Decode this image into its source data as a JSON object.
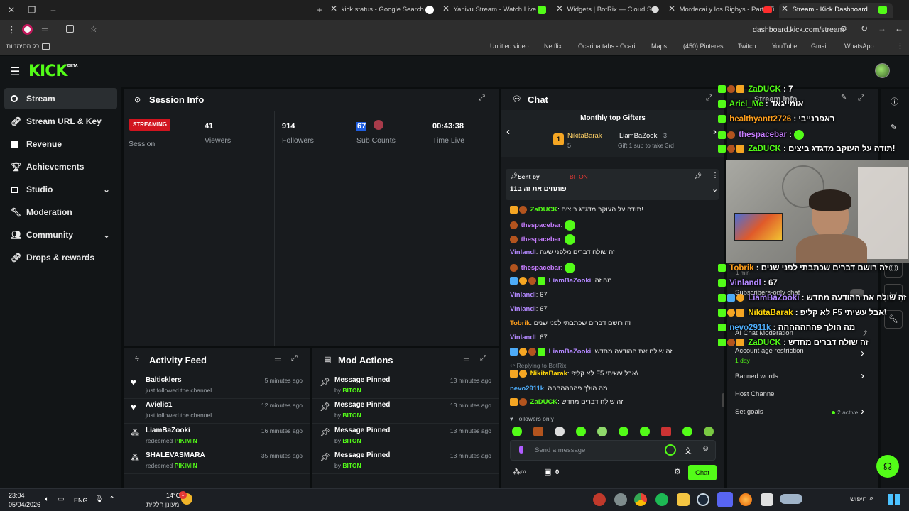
{
  "browser": {
    "tabs": [
      {
        "title": "kick status - Google Search",
        "color": "#4285f4"
      },
      {
        "title": "Yanivu Stream - Watch Live on",
        "color": "#53fc18"
      },
      {
        "title": "Widgets | BotRix — Cloud Stre",
        "color": "#dddddd"
      },
      {
        "title": "Mordecai y los Rigbys - Party Ti",
        "color": "#ff2d2d"
      },
      {
        "title": "Stream - Kick Dashboard",
        "color": "#53fc18"
      }
    ],
    "url": "dashboard.kick.com/stream",
    "bookmarks_folder": "כל הסימניות",
    "bookmarks": [
      "Untitled video",
      "Netflix",
      "Ocarina tabs - Ocari...",
      "Maps",
      "(450) Pinterest",
      "Twitch",
      "YouTube",
      "Gmail",
      "WhatsApp"
    ]
  },
  "app": {
    "logo": "KICK",
    "logo_tag": "BETA",
    "sidebar": [
      {
        "label": "Stream",
        "icon": "stream-icon"
      },
      {
        "label": "Stream URL & Key",
        "icon": "link-icon"
      },
      {
        "label": "Revenue",
        "icon": "chart-icon"
      },
      {
        "label": "Achievements",
        "icon": "trophy-icon"
      },
      {
        "label": "Studio",
        "icon": "studio-icon"
      },
      {
        "label": "Moderation",
        "icon": "wrench-icon"
      },
      {
        "label": "Community",
        "icon": "community-icon"
      },
      {
        "label": "Drops & rewards",
        "icon": "drops-icon"
      }
    ]
  },
  "session": {
    "title": "Session Info",
    "status_badge": "STREAMING",
    "status_label": "Session",
    "stats": [
      {
        "value": "41",
        "label": "Viewers"
      },
      {
        "value": "914",
        "label": "Followers"
      },
      {
        "value": "67",
        "label": "Sub Counts"
      },
      {
        "value": "00:43:38",
        "label": "Time Live"
      }
    ]
  },
  "activity": {
    "title": "Activity Feed",
    "items": [
      {
        "name": "Balticklers",
        "action": "just followed the channel",
        "reward": "",
        "time": "5 minutes ago",
        "icon": "heart-icon"
      },
      {
        "name": "Avielic1",
        "action": "just followed the channel",
        "reward": "",
        "time": "12 minutes ago",
        "icon": "heart-icon"
      },
      {
        "name": "LiamBaZooki",
        "action": "redeemed",
        "reward": "PIKIMIN",
        "time": "16 minutes ago",
        "icon": "reward-icon"
      },
      {
        "name": "SHALEVASMARA",
        "action": "redeemed",
        "reward": "PIKIMIN",
        "time": "35 minutes ago",
        "icon": "reward-icon"
      }
    ]
  },
  "mod": {
    "title": "Mod Actions",
    "items": [
      {
        "action": "Message Pinned",
        "by": "by",
        "who": "BITON",
        "time": "13 minutes ago"
      },
      {
        "action": "Message Pinned",
        "by": "by",
        "who": "BITON",
        "time": "13 minutes ago"
      },
      {
        "action": "Message Pinned",
        "by": "by",
        "who": "BITON",
        "time": "13 minutes ago"
      },
      {
        "action": "Message Pinned",
        "by": "by",
        "who": "BITON",
        "time": "13 minutes ago"
      }
    ]
  },
  "chat": {
    "title": "Chat",
    "gifters_title": "Monthly top Gifters",
    "gifter1_name": "NikitaBarak",
    "gifter1_count": "5",
    "gifter1_rank": "1",
    "gifter2_name": "LiamBaZooki",
    "gifter2_count": "3",
    "gifter_cta": "Gift 1 sub to take 3rd",
    "pinned_label": "Sent by",
    "pinned_user": "BITON",
    "pinned_text": "פותחים את זה ב11",
    "messages": [
      {
        "user": "ZaDUCK",
        "color": "#53fc18",
        "text": "תודה על העוקב מדגדג ביצים!"
      },
      {
        "user": "thespacebar",
        "color": "#c77dff",
        "text": ""
      },
      {
        "user": "thespacebar",
        "color": "#c77dff",
        "text": ""
      },
      {
        "user": "Vinlandl",
        "color": "#b388ff",
        "text": "זה שולח דברים מלפני שעה"
      },
      {
        "user": "thespacebar",
        "color": "#c77dff",
        "text": ""
      },
      {
        "user": "LiamBaZooki",
        "color": "#b388ff",
        "text": "מה זה"
      },
      {
        "user": "Vinlandl",
        "color": "#b388ff",
        "text": "67"
      },
      {
        "user": "Vinlandl",
        "color": "#b388ff",
        "text": "67"
      },
      {
        "user": "Tobrik",
        "color": "#ff9f1c",
        "text": "זה רושם דברים שכתבתי לפני שנים"
      },
      {
        "user": "Vinlandl",
        "color": "#b388ff",
        "text": "67"
      },
      {
        "user": "LiamBaZooki",
        "color": "#b388ff",
        "text": "זה שולח את ההודעה מחדש"
      }
    ],
    "reply_hint": "Replying to BotRix:",
    "messages2": [
      {
        "user": "NikitaBarak",
        "color": "#ffd60a",
        "text": "לא קליפ F5 אבל עשיתי\\"
      },
      {
        "user": "nevo2911k",
        "color": "#4dabf7",
        "text": "מה הולך פההההההה"
      },
      {
        "user": "ZaDUCK",
        "color": "#53fc18",
        "text": "זה שולח דברים מחדש"
      }
    ],
    "followers_only": "Followers only",
    "input_placeholder": "Send a message",
    "points": "0",
    "send_label": "Chat"
  },
  "stream_info": {
    "title": "Stream info",
    "settings": [
      {
        "label": "Subscribers-only chat",
        "value": ""
      },
      {
        "label": "AI Chat Moderation",
        "value": ""
      },
      {
        "label": "Account age restriction",
        "value": "1 day"
      },
      {
        "label": "Banned words",
        "value": ""
      },
      {
        "label": "Host Channel",
        "value": ""
      },
      {
        "label": "Set goals",
        "value": "2 active"
      }
    ],
    "partial_text": "1 min"
  },
  "overlay": {
    "lines": [
      {
        "user": "ZaDUCK",
        "sep": " : ",
        "text": "7",
        "color": "#53fc18"
      },
      {
        "user": "Ariel_Me",
        "sep": " : ",
        "text": "אומייגאד",
        "color": "#53fc18"
      },
      {
        "user": "healthyantt2726",
        "sep": " : ",
        "text": "ראפרנייבי",
        "color": "#ff9f1c"
      },
      {
        "user": "thespacebar",
        "sep": " : ",
        "text": "",
        "color": "#c77dff"
      },
      {
        "user": "ZaDUCK",
        "sep": " : ",
        "text": "תודה על העוקב מדגדג ביצים!",
        "color": "#53fc18"
      },
      {
        "user": "Tobrik",
        "sep": " : ",
        "text": "זה רושם דברים שכתבתי לפני שנים",
        "color": "#ff9f1c"
      },
      {
        "user": "Vinlandl",
        "sep": " : ",
        "text": "67",
        "color": "#b388ff"
      },
      {
        "user": "LiamBaZooki",
        "sep": " : ",
        "text": "זה שולח את ההודעה מחדש",
        "color": "#b388ff"
      },
      {
        "user": "NikitaBarak",
        "sep": " : ",
        "text": "לא קליפ F5 אבל עשיתי\\",
        "color": "#ffd60a"
      },
      {
        "user": "nevo2911k",
        "sep": " : ",
        "text": "מה הולך פההההההה",
        "color": "#4dabf7"
      },
      {
        "user": "ZaDUCK",
        "sep": " : ",
        "text": "זה שולח דברים מחדש",
        "color": "#53fc18"
      }
    ]
  },
  "taskbar": {
    "time": "23:04",
    "date": "05/04/2026",
    "lang": "ENG",
    "weather_temp": "14°C",
    "weather_desc": "מעונן חלקית",
    "weather_badge": "1",
    "search": "חיפוש"
  },
  "colors": {
    "accent": "#53fc18",
    "bg": "#0b0e0f",
    "panel": "#181b1e",
    "streaming": "#d1141f"
  }
}
